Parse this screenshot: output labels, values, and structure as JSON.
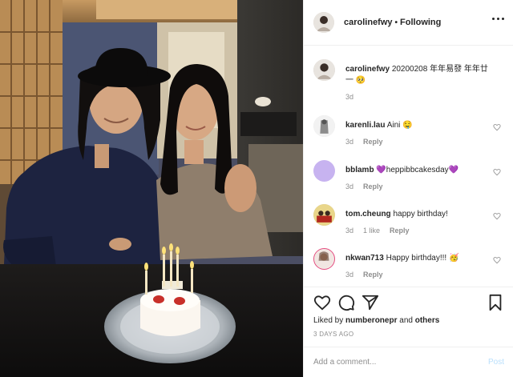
{
  "post": {
    "username": "carolinefwy",
    "separator": "•",
    "follow_status": "Following"
  },
  "caption": {
    "username": "carolinefwy",
    "text": "20200208 年年易發 年年廿一 🥺",
    "time": "3d"
  },
  "comments": [
    {
      "username": "karenli.lau",
      "text": "Aini 🤤",
      "time": "3d",
      "reply": "Reply",
      "likes": ""
    },
    {
      "username": "bblamb",
      "text": "💜heppibbcakesday💜",
      "time": "3d",
      "reply": "Reply",
      "likes": ""
    },
    {
      "username": "tom.cheung",
      "text": "happy birthday!",
      "time": "3d",
      "reply": "Reply",
      "likes": "1 like"
    },
    {
      "username": "nkwan713",
      "text": "Happy birthday!!! 🥳",
      "time": "3d",
      "reply": "Reply",
      "likes": ""
    }
  ],
  "actions": {
    "liked_by_prefix": "Liked by",
    "liked_by_user": "numberonepr",
    "liked_by_and": "and",
    "liked_by_others": "others",
    "posted_ago": "3 DAYS AGO"
  },
  "add_comment": {
    "placeholder": "Add a comment...",
    "post_label": "Post"
  },
  "colors": {
    "text": "#262626",
    "muted": "#8e8e8e",
    "border": "#efefef",
    "post_disabled": "#b9dffc",
    "bblamb_avatar": "#c7b3f0"
  },
  "icons": [
    "more-options-icon",
    "heart-icon",
    "comment-icon",
    "share-icon",
    "bookmark-icon"
  ]
}
